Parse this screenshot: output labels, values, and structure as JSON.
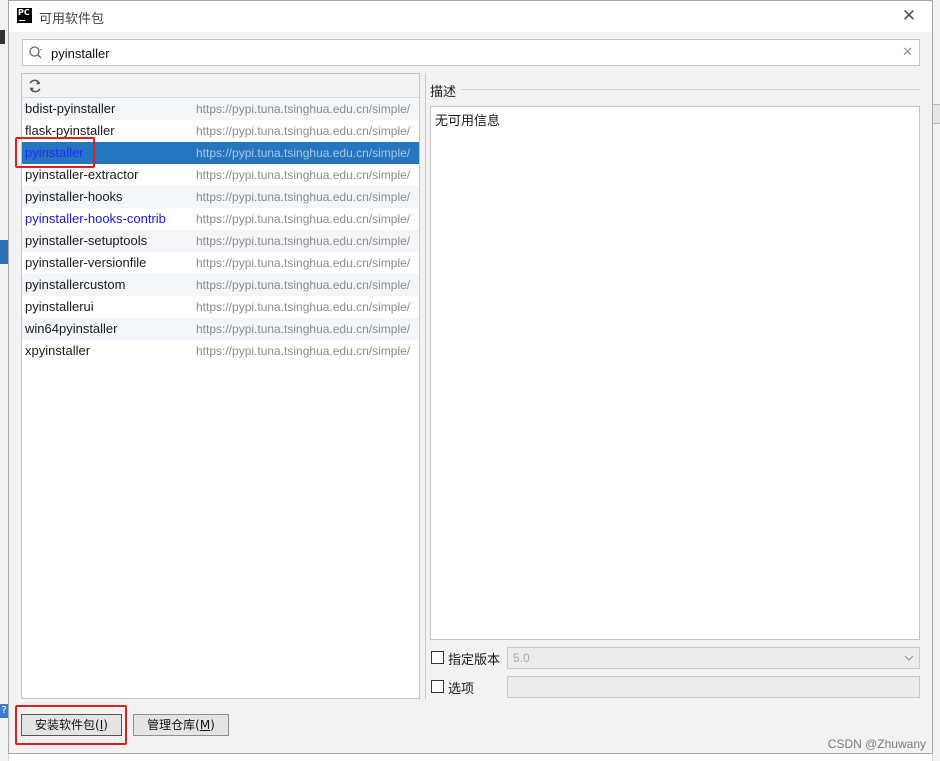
{
  "window": {
    "title": "可用软件包",
    "app_icon_text": "PC"
  },
  "search": {
    "value": "pyinstaller",
    "placeholder": ""
  },
  "packages": [
    {
      "name": "bdist-pyinstaller",
      "repo": "https://pypi.tuna.tsinghua.edu.cn/simple/"
    },
    {
      "name": "flask-pyinstaller",
      "repo": "https://pypi.tuna.tsinghua.edu.cn/simple/"
    },
    {
      "name": "pyinstaller",
      "repo": "https://pypi.tuna.tsinghua.edu.cn/simple/",
      "selected": true
    },
    {
      "name": "pyinstaller-extractor",
      "repo": "https://pypi.tuna.tsinghua.edu.cn/simple/"
    },
    {
      "name": "pyinstaller-hooks",
      "repo": "https://pypi.tuna.tsinghua.edu.cn/simple/"
    },
    {
      "name": "pyinstaller-hooks-contrib",
      "repo": "https://pypi.tuna.tsinghua.edu.cn/simple/",
      "highlight": true
    },
    {
      "name": "pyinstaller-setuptools",
      "repo": "https://pypi.tuna.tsinghua.edu.cn/simple/"
    },
    {
      "name": "pyinstaller-versionfile",
      "repo": "https://pypi.tuna.tsinghua.edu.cn/simple/"
    },
    {
      "name": "pyinstallercustom",
      "repo": "https://pypi.tuna.tsinghua.edu.cn/simple/"
    },
    {
      "name": "pyinstallerui",
      "repo": "https://pypi.tuna.tsinghua.edu.cn/simple/"
    },
    {
      "name": "win64pyinstaller",
      "repo": "https://pypi.tuna.tsinghua.edu.cn/simple/"
    },
    {
      "name": "xpyinstaller",
      "repo": "https://pypi.tuna.tsinghua.edu.cn/simple/"
    }
  ],
  "description": {
    "label": "描述",
    "text": "无可用信息"
  },
  "options": {
    "specify_version_label": "指定版本",
    "version_value": "5.0",
    "options_label": "选项",
    "options_value": ""
  },
  "buttons": {
    "install_label": "安装软件包(",
    "install_mnemonic": "I",
    "install_suffix": ")",
    "manage_label": "管理仓库(",
    "manage_mnemonic": "M",
    "manage_suffix": ")"
  },
  "watermark": "CSDN @Zhuwany",
  "colors": {
    "selection": "#2675bf",
    "highlight_box": "#e02020",
    "link_blue": "#1a1acc"
  },
  "icons": [
    "app-icon",
    "close-icon",
    "search-icon",
    "clear-icon",
    "refresh-icon",
    "chevron-down-icon"
  ]
}
